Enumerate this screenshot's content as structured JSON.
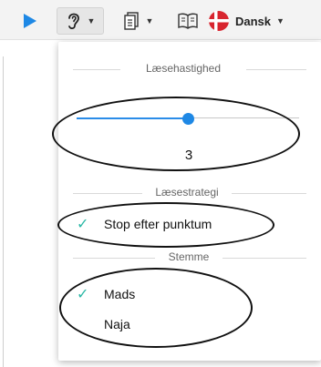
{
  "toolbar": {
    "play_icon": "play-icon",
    "ear_icon": "ear-icon",
    "page_icon": "page-icon",
    "book_icon": "book-icon",
    "flag_icon": "danish-flag-icon",
    "language_label": "Dansk"
  },
  "menu": {
    "speed_title": "Læsehastighed",
    "speed_value": "3",
    "speed_fraction": 0.5,
    "strategy_title": "Læsestrategi",
    "strategy_items": [
      {
        "label": "Stop efter punktum",
        "checked": true
      }
    ],
    "voice_title": "Stemme",
    "voice_items": [
      {
        "label": "Mads",
        "checked": true
      },
      {
        "label": "Naja",
        "checked": false
      }
    ]
  },
  "colors": {
    "accent": "#1e88e5",
    "check": "#2bb8a6",
    "flag_red": "#d8252f"
  }
}
